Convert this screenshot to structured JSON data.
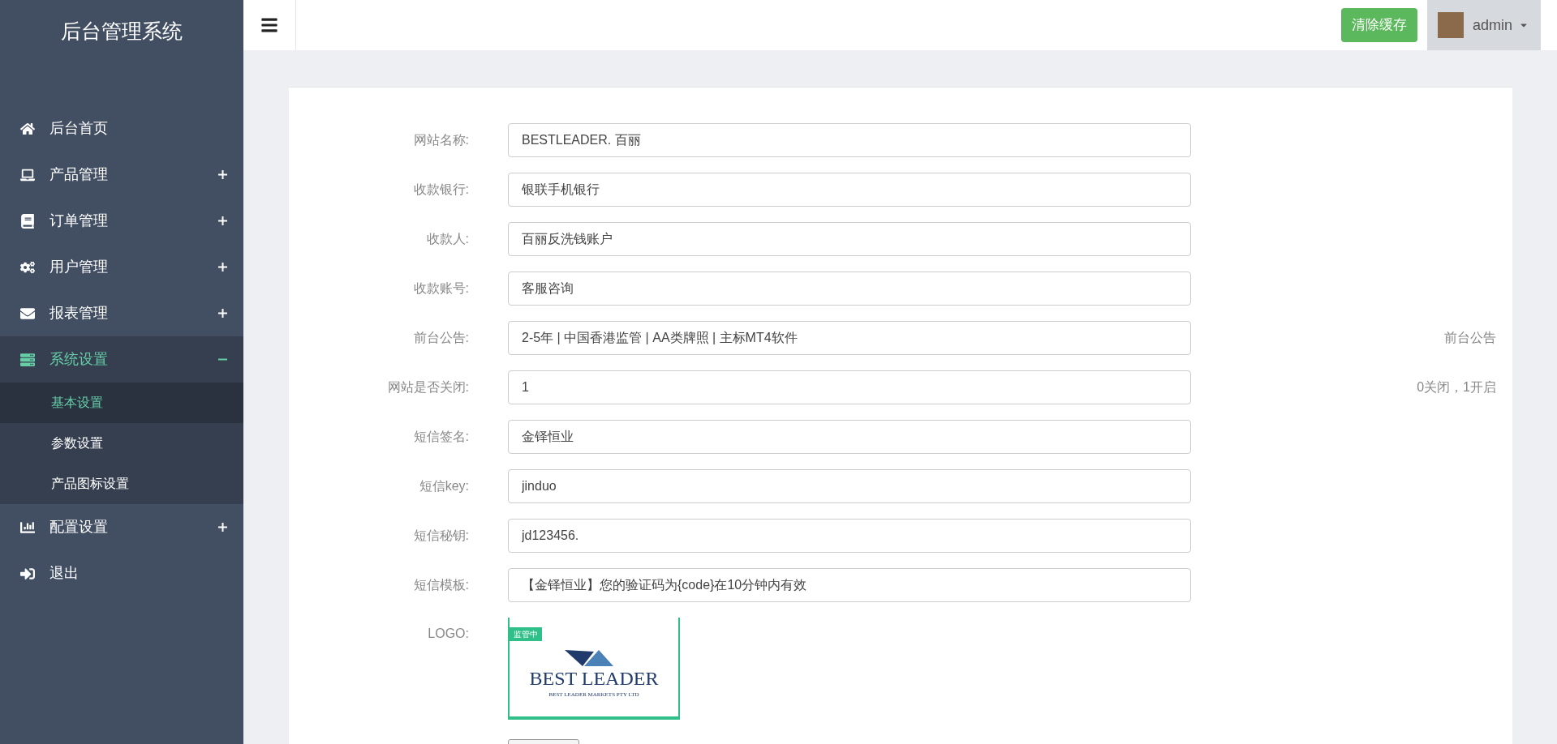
{
  "sidebar": {
    "title": "后台管理系统",
    "items": [
      {
        "label": "后台首页",
        "selected": false
      },
      {
        "label": "产品管理",
        "expanded": false,
        "selected": false
      },
      {
        "label": "订单管理",
        "expanded": false,
        "selected": false
      },
      {
        "label": "用户管理",
        "expanded": false,
        "selected": false
      },
      {
        "label": "报表管理",
        "expanded": false,
        "selected": false
      },
      {
        "label": "系统设置",
        "expanded": true,
        "selected": true,
        "children": [
          {
            "label": "基本设置",
            "selected": true
          },
          {
            "label": "参数设置",
            "selected": false
          },
          {
            "label": "产品图标设置",
            "selected": false
          }
        ]
      },
      {
        "label": "配置设置",
        "expanded": false,
        "selected": false
      },
      {
        "label": "退出",
        "selected": false
      }
    ]
  },
  "header": {
    "clear_cache_button": "清除缓存",
    "user": "admin"
  },
  "form": {
    "fields": [
      {
        "label": "网站名称:",
        "value": "BESTLEADER. 百丽"
      },
      {
        "label": "收款银行:",
        "value": "银联手机银行"
      },
      {
        "label": "收款人:",
        "value": "百丽反洗钱账户"
      },
      {
        "label": "收款账号:",
        "value": "客服咨询"
      },
      {
        "label": "前台公告:",
        "value": "2-5年 | 中国香港监管 | AA类牌照 | 主标MT4软件",
        "hint": "前台公告"
      },
      {
        "label": "网站是否关闭:",
        "value": "1",
        "hint": "0关闭，1开启"
      },
      {
        "label": "短信签名:",
        "value": "金铎恒业"
      },
      {
        "label": "短信key:",
        "value": "jinduo"
      },
      {
        "label": "短信秘钥:",
        "value": "jd123456."
      },
      {
        "label": "短信模板:",
        "value": "【金铎恒业】您的验证码为{code}在10分钟内有效"
      }
    ],
    "logo": {
      "label": "LOGO:",
      "badge": "监管中",
      "brand": "BEST LEADER",
      "tagline": "BEST LEADER MARKETS PTY LTD"
    }
  }
}
